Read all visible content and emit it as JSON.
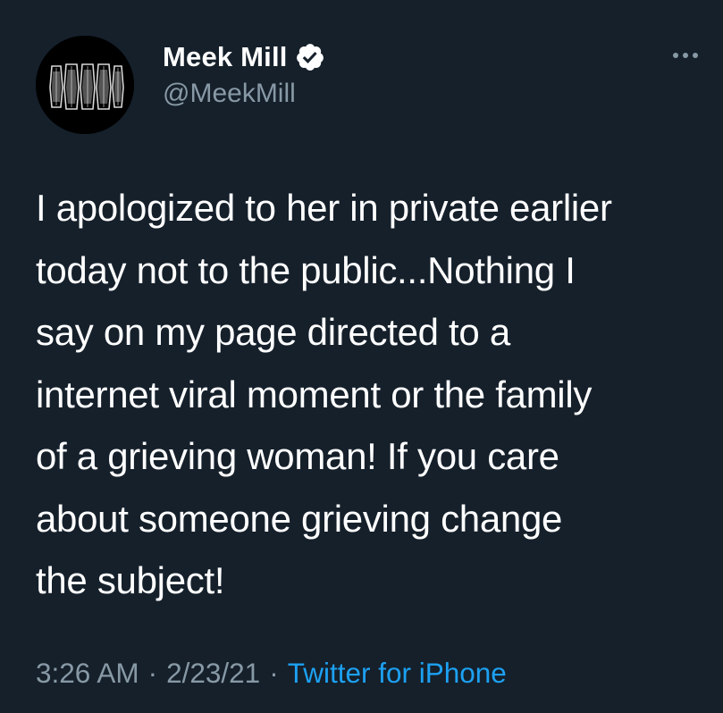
{
  "user": {
    "display_name": "Meek Mill",
    "handle": "@MeekMill",
    "verified": true
  },
  "tweet": {
    "text": "I apologized to her in private earlier\ntoday not to the public...Nothing I\nsay on my page directed to a\ninternet viral moment or the family\nof a grieving woman! If you care\nabout someone grieving change\nthe subject!",
    "time": "3:26 AM",
    "date": "2/23/21",
    "separator": "·",
    "source": "Twitter for iPhone"
  },
  "icons": {
    "verified": "verified-badge-icon",
    "more": "more-options-icon"
  },
  "colors": {
    "background": "#15202b",
    "primary_text": "#ffffff",
    "secondary_text": "#8899a6",
    "link": "#1da1f2"
  }
}
